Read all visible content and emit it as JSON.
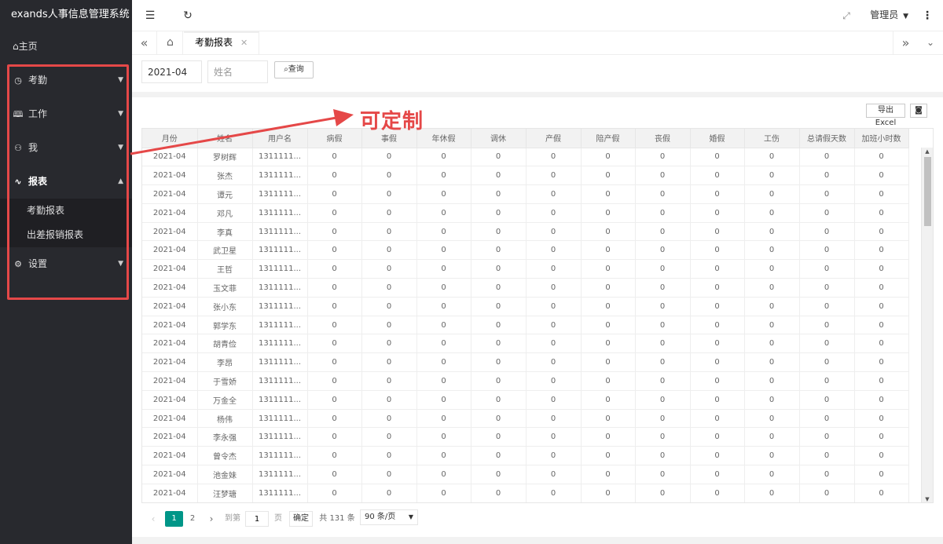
{
  "app_title": "exands人事信息管理系统",
  "sidebar": {
    "home": "主页",
    "items": [
      {
        "label": "考勤",
        "icon": "clock-icon",
        "expanded": false
      },
      {
        "label": "工作",
        "icon": "book-icon",
        "expanded": false
      },
      {
        "label": "我",
        "icon": "user-icon",
        "expanded": false
      },
      {
        "label": "报表",
        "icon": "pulse-icon",
        "expanded": true
      },
      {
        "label": "设置",
        "icon": "gear-icon",
        "expanded": false
      }
    ],
    "subitems": [
      "考勤报表",
      "出差报销报表"
    ]
  },
  "header": {
    "admin": "管理员"
  },
  "tabs": {
    "active": "考勤报表"
  },
  "search": {
    "month_value": "2021-04",
    "name_placeholder": "姓名",
    "query_label": "查询"
  },
  "toolbar": {
    "export_label": "导出Excel"
  },
  "annotation": "可定制",
  "table": {
    "columns": [
      "月份",
      "姓名",
      "用户名",
      "病假",
      "事假",
      "年休假",
      "调休",
      "产假",
      "陪产假",
      "丧假",
      "婚假",
      "工伤",
      "总请假天数",
      "加班小时数"
    ],
    "rows": [
      [
        "2021-04",
        "罗树辉",
        "1311111...",
        "0",
        "0",
        "0",
        "0",
        "0",
        "0",
        "0",
        "0",
        "0",
        "0",
        "0"
      ],
      [
        "2021-04",
        "张杰",
        "1311111...",
        "0",
        "0",
        "0",
        "0",
        "0",
        "0",
        "0",
        "0",
        "0",
        "0",
        "0"
      ],
      [
        "2021-04",
        "谭元",
        "1311111...",
        "0",
        "0",
        "0",
        "0",
        "0",
        "0",
        "0",
        "0",
        "0",
        "0",
        "0"
      ],
      [
        "2021-04",
        "邓凡",
        "1311111...",
        "0",
        "0",
        "0",
        "0",
        "0",
        "0",
        "0",
        "0",
        "0",
        "0",
        "0"
      ],
      [
        "2021-04",
        "李真",
        "1311111...",
        "0",
        "0",
        "0",
        "0",
        "0",
        "0",
        "0",
        "0",
        "0",
        "0",
        "0"
      ],
      [
        "2021-04",
        "武卫星",
        "1311111...",
        "0",
        "0",
        "0",
        "0",
        "0",
        "0",
        "0",
        "0",
        "0",
        "0",
        "0"
      ],
      [
        "2021-04",
        "王哲",
        "1311111...",
        "0",
        "0",
        "0",
        "0",
        "0",
        "0",
        "0",
        "0",
        "0",
        "0",
        "0"
      ],
      [
        "2021-04",
        "玉文菲",
        "1311111...",
        "0",
        "0",
        "0",
        "0",
        "0",
        "0",
        "0",
        "0",
        "0",
        "0",
        "0"
      ],
      [
        "2021-04",
        "张小东",
        "1311111...",
        "0",
        "0",
        "0",
        "0",
        "0",
        "0",
        "0",
        "0",
        "0",
        "0",
        "0"
      ],
      [
        "2021-04",
        "郭学东",
        "1311111...",
        "0",
        "0",
        "0",
        "0",
        "0",
        "0",
        "0",
        "0",
        "0",
        "0",
        "0"
      ],
      [
        "2021-04",
        "胡青俭",
        "1311111...",
        "0",
        "0",
        "0",
        "0",
        "0",
        "0",
        "0",
        "0",
        "0",
        "0",
        "0"
      ],
      [
        "2021-04",
        "李昂",
        "1311111...",
        "0",
        "0",
        "0",
        "0",
        "0",
        "0",
        "0",
        "0",
        "0",
        "0",
        "0"
      ],
      [
        "2021-04",
        "于雪娇",
        "1311111...",
        "0",
        "0",
        "0",
        "0",
        "0",
        "0",
        "0",
        "0",
        "0",
        "0",
        "0"
      ],
      [
        "2021-04",
        "万金全",
        "1311111...",
        "0",
        "0",
        "0",
        "0",
        "0",
        "0",
        "0",
        "0",
        "0",
        "0",
        "0"
      ],
      [
        "2021-04",
        "杨伟",
        "1311111...",
        "0",
        "0",
        "0",
        "0",
        "0",
        "0",
        "0",
        "0",
        "0",
        "0",
        "0"
      ],
      [
        "2021-04",
        "李永强",
        "1311111...",
        "0",
        "0",
        "0",
        "0",
        "0",
        "0",
        "0",
        "0",
        "0",
        "0",
        "0"
      ],
      [
        "2021-04",
        "曾令杰",
        "1311111...",
        "0",
        "0",
        "0",
        "0",
        "0",
        "0",
        "0",
        "0",
        "0",
        "0",
        "0"
      ],
      [
        "2021-04",
        "池金妹",
        "1311111...",
        "0",
        "0",
        "0",
        "0",
        "0",
        "0",
        "0",
        "0",
        "0",
        "0",
        "0"
      ],
      [
        "2021-04",
        "汪梦瑭",
        "1311111...",
        "0",
        "0",
        "0",
        "0",
        "0",
        "0",
        "0",
        "0",
        "0",
        "0",
        "0"
      ]
    ]
  },
  "pager": {
    "pages": [
      "1",
      "2"
    ],
    "current": "1",
    "goto_label": "到第",
    "goto_value": "1",
    "page_unit": "页",
    "confirm_label": "确定",
    "total_text": "共 131 条",
    "page_size": "90 条/页"
  },
  "colors": {
    "sidebar_bg": "#28292e",
    "accent": "#009688",
    "annotation": "#e54848"
  }
}
